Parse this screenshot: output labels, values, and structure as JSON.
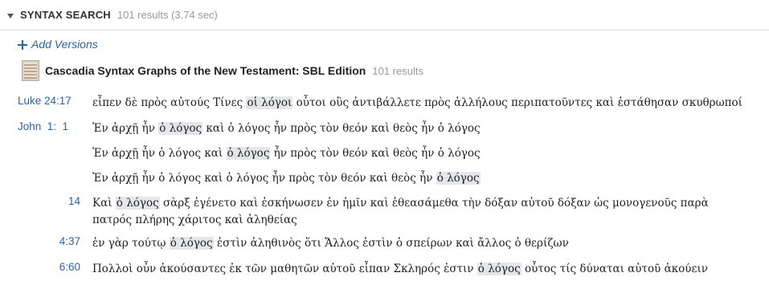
{
  "header": {
    "title": "SYNTAX SEARCH",
    "count": "101 results (3.74 sec)"
  },
  "add_versions": "Add Versions",
  "resource": {
    "title": "Cascadia Syntax Graphs of the New Testament: SBL Edition",
    "count": "101 results"
  },
  "results": [
    {
      "ref": "Luke 24:17",
      "pre": "εἶπεν δὲ πρὸς αὐτούς Τίνες ",
      "hit": "οἱ λόγοι",
      "post": " οὗτοι οὓς ἀντιβάλλετε πρὸς ἀλλήλους περιπατοῦντες καὶ ἐστάθησαν σκυθρωποί"
    },
    {
      "ref": "John  1:  1",
      "pre": "Ἐν ἀρχῇ ἦν ",
      "hit": "ὁ λόγος",
      "post": " καὶ ὁ λόγος ἦν πρὸς τὸν θεόν καὶ θεὸς ἦν ὁ λόγος"
    },
    {
      "ref": "",
      "pre": "Ἐν ἀρχῇ ἦν ὁ λόγος καὶ ",
      "hit": "ὁ λόγος",
      "post": " ἦν πρὸς τὸν θεόν καὶ θεὸς ἦν ὁ λόγος"
    },
    {
      "ref": "",
      "pre": "Ἐν ἀρχῇ ἦν ὁ λόγος καὶ ὁ λόγος ἦν πρὸς τὸν θεόν καὶ θεὸς ἦν ",
      "hit": "ὁ λόγος",
      "post": ""
    },
    {
      "ref": "14",
      "pre": "Καὶ ",
      "hit": "ὁ λόγος",
      "post": " σὰρξ ἐγένετο καὶ ἐσκήνωσεν ἐν ἡμῖν καὶ ἐθεασάμεθα τὴν δόξαν αὐτοῦ δόξαν ὡς μονογενοῦς παρὰ πατρός πλήρης χάριτος καὶ ἀληθείας"
    },
    {
      "ref": "4:37",
      "pre": "ἐν γὰρ τούτῳ ",
      "hit": "ὁ λόγος",
      "post": " ἐστὶν ἀληθινὸς ὅτι Ἄλλος ἐστὶν ὁ σπείρων καὶ ἄλλος ὁ θερίζων"
    },
    {
      "ref": "6:60",
      "pre": "Πολλοὶ οὖν ἀκούσαντες ἐκ τῶν μαθητῶν αὐτοῦ εἶπαν Σκληρός ἐστιν ",
      "hit": "ὁ λόγος",
      "post": " οὗτος τίς δύναται αὐτοῦ ἀκούειν"
    }
  ],
  "colors": {
    "link": "#2b63a8",
    "highlight": "#e4e6ea",
    "muted": "#9a9a9a"
  },
  "icons": [
    "collapse-arrow-icon",
    "plus-icon",
    "book-cover-icon"
  ]
}
